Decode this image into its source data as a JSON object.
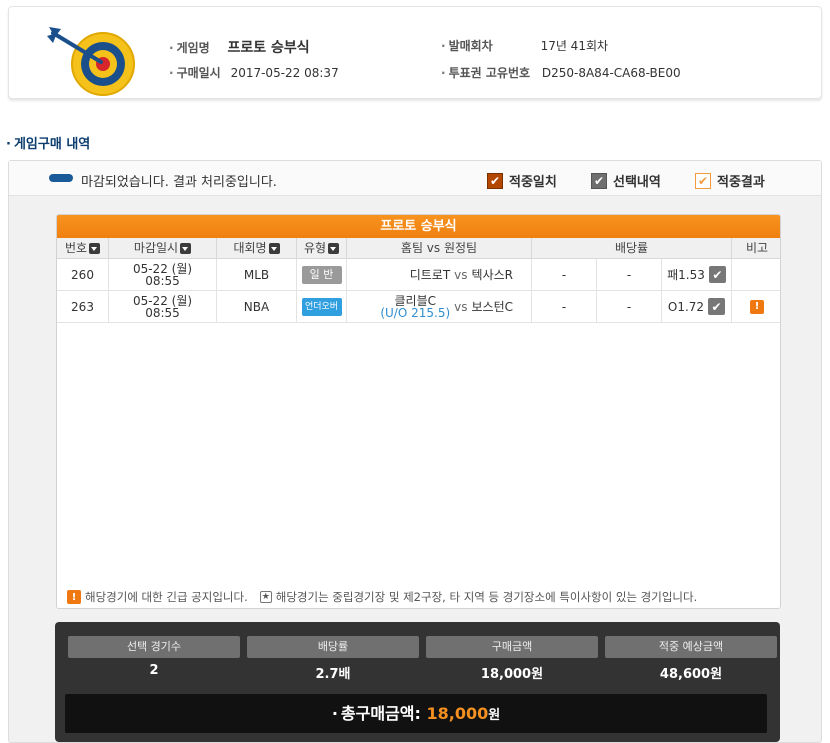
{
  "header": {
    "game_name_label": "게임명",
    "game_name": "프로토 승부식",
    "purchase_date_label": "구매일시",
    "purchase_date": "2017-05-22 08:37",
    "round_label": "발매회차",
    "round": "17년 41회차",
    "ticket_id_label": "투표권 고유번호",
    "ticket_id": "D250-8A84-CA68-BE00"
  },
  "section_title": "게임구매 내역",
  "status": {
    "text": "마감되었습니다. 결과 처리중입니다.",
    "legend": [
      "적중일치",
      "선택내역",
      "적중결과"
    ],
    "legend_colors": [
      "#b34700",
      "#6f6f6f",
      "#f39c3f"
    ]
  },
  "table": {
    "title": "프로토 승부식",
    "headers": [
      "번호",
      "마감일시",
      "대회명",
      "유형",
      "홈팀 vs 원정팀",
      "배당률",
      "비고"
    ],
    "rows": [
      {
        "no": "260",
        "date1": "05-22 (월)",
        "date2": "08:55",
        "league": "MLB",
        "type": "일 반",
        "type_color": "#9a9a9a",
        "home": "디트로T",
        "home_sub": "",
        "vs": "vs",
        "away": "텍사스R",
        "odd1": "-",
        "odd2": "-",
        "pick": "패1.53",
        "note": ""
      },
      {
        "no": "263",
        "date1": "05-22 (월)",
        "date2": "08:55",
        "league": "NBA",
        "type": "언더오버",
        "type_color": "#2f9fe0",
        "home": "클리블C",
        "home_sub": "(U/O 215.5)",
        "vs": "vs",
        "away": "보스턴C",
        "odd1": "-",
        "odd2": "-",
        "pick": "O1.72",
        "note": "!"
      }
    ],
    "footnote_urgent": "해당경기에 대한 긴급 공지입니다.",
    "footnote_star": "해당경기는 중립경기장 및 제2구장, 타 지역 등 경기장소에 특이사항이 있는 경기입니다."
  },
  "summary": {
    "headers": [
      "선택 경기수",
      "배당률",
      "구매금액",
      "적중 예상금액"
    ],
    "values": [
      "2",
      "2.7배",
      "18,000원",
      "48,600원"
    ],
    "total_label": "총구매금액:",
    "total_amount": "18,000",
    "total_unit": "원"
  }
}
